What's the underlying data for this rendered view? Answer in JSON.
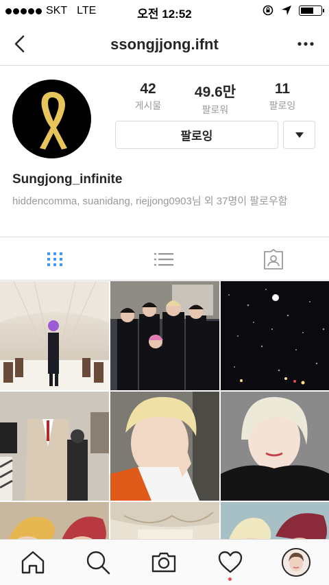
{
  "status_bar": {
    "carrier": "SKT",
    "network": "LTE",
    "time": "오전 12:52",
    "battery_level": 0.7
  },
  "header": {
    "username": "ssongjjong.ifnt"
  },
  "profile": {
    "stats": [
      {
        "value": "42",
        "label": "게시물"
      },
      {
        "value": "49.6만",
        "label": "팔로워"
      },
      {
        "value": "11",
        "label": "팔로잉"
      }
    ],
    "follow_button_label": "팔로잉",
    "display_name": "Sungjong_infinite",
    "followed_by": "hiddencomma, suanidang, riejjong0903님 외 37명이 팔로우함"
  },
  "tabs": [
    {
      "icon": "grid-icon",
      "active": true
    },
    {
      "icon": "list-icon",
      "active": false
    },
    {
      "icon": "tagged-icon",
      "active": false
    }
  ],
  "bottom_nav": [
    {
      "icon": "home-icon"
    },
    {
      "icon": "search-icon"
    },
    {
      "icon": "camera-icon"
    },
    {
      "icon": "heart-icon",
      "has_notification": true
    },
    {
      "icon": "profile-avatar-icon"
    }
  ],
  "colors": {
    "active_tab": "#3897f0",
    "ribbon": "#e8c55a",
    "notification": "#ed4956",
    "border": "#dbdbdb",
    "muted_text": "#999999"
  }
}
